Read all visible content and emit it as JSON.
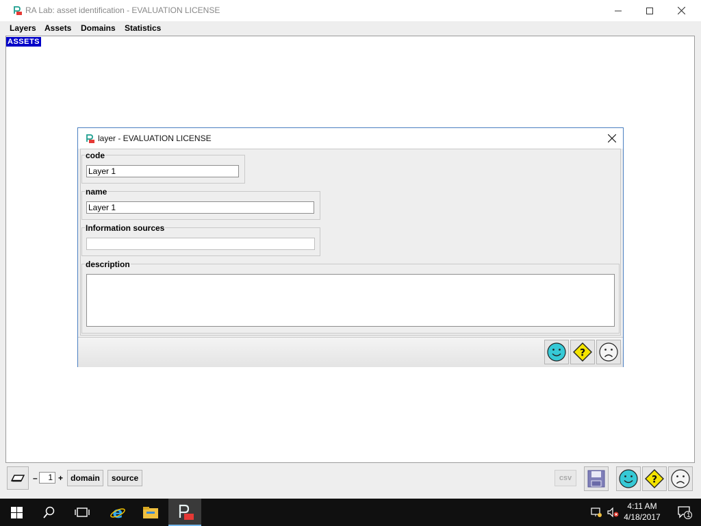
{
  "window": {
    "title": "RA Lab: asset identification - EVALUATION LICENSE"
  },
  "menu": [
    "Layers",
    "Assets",
    "Domains",
    "Statistics"
  ],
  "canvas": {
    "tag": "ASSETS"
  },
  "dialog": {
    "title": "layer - EVALUATION LICENSE",
    "code": {
      "label": "code",
      "value": "Layer 1"
    },
    "name": {
      "label": "name",
      "value": "Layer 1"
    },
    "sources": {
      "label": "Information sources",
      "value": ""
    },
    "description": {
      "label": "description",
      "value": ""
    },
    "buttons": [
      "ok-smiley-icon",
      "help-question-icon",
      "cancel-frown-icon"
    ]
  },
  "toolbar": {
    "minus": "–",
    "level": "1",
    "plus": "+",
    "domain_label": "domain",
    "source_label": "source",
    "csv_label": "csv"
  },
  "taskbar": {
    "time": "4:11 AM",
    "date": "4/18/2017",
    "notification_count": "1"
  },
  "colors": {
    "accent": "#0000c8",
    "smiley": "#36c9d6",
    "warning": "#f4e400"
  }
}
